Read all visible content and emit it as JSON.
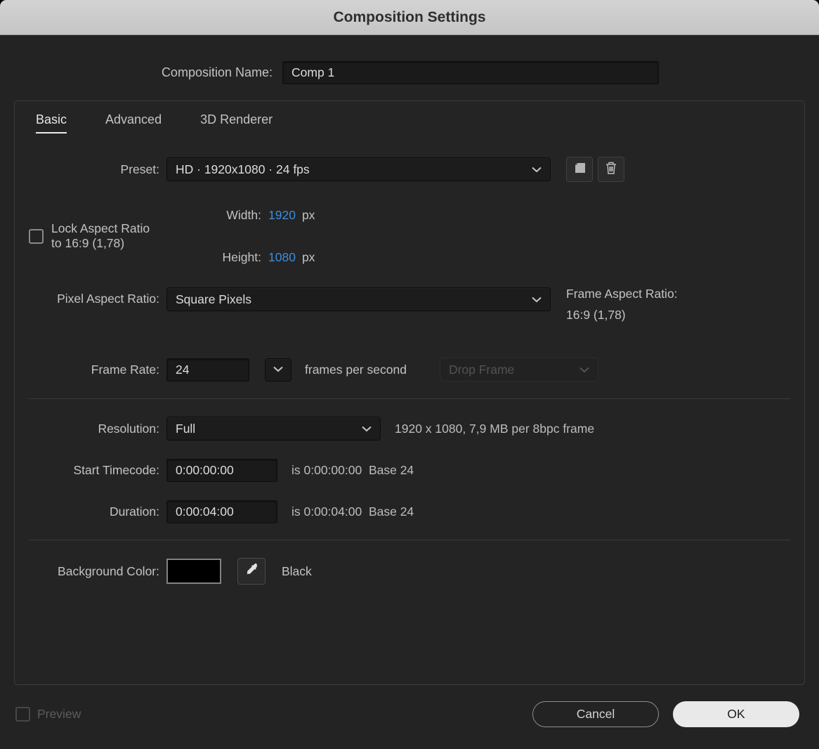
{
  "dialog": {
    "title": "Composition Settings"
  },
  "composition_name": {
    "label": "Composition Name:",
    "value": "Comp 1"
  },
  "tabs": {
    "basic": "Basic",
    "advanced": "Advanced",
    "renderer": "3D Renderer"
  },
  "preset": {
    "label": "Preset:",
    "value": "HD  ·  1920x1080 · 24 fps"
  },
  "dimensions": {
    "width_label": "Width:",
    "width_value": "1920",
    "width_unit": "px",
    "height_label": "Height:",
    "height_value": "1080",
    "height_unit": "px",
    "lock_aspect_label": "Lock Aspect Ratio to 16:9 (1,78)"
  },
  "pixel_aspect_ratio": {
    "label": "Pixel Aspect Ratio:",
    "value": "Square Pixels",
    "frame_aspect_label": "Frame Aspect Ratio:",
    "frame_aspect_value": "16:9 (1,78)"
  },
  "frame_rate": {
    "label": "Frame Rate:",
    "value": "24",
    "suffix": "frames per second",
    "drop_frame": "Drop Frame"
  },
  "resolution": {
    "label": "Resolution:",
    "value": "Full",
    "info": "1920 x 1080, 7,9 MB per 8bpc frame"
  },
  "start_timecode": {
    "label": "Start Timecode:",
    "value": "0:00:00:00",
    "info": "is 0:00:00:00  Base 24"
  },
  "duration": {
    "label": "Duration:",
    "value": "0:00:04:00",
    "info": "is 0:00:04:00  Base 24"
  },
  "background_color": {
    "label": "Background Color:",
    "swatch_color": "#000000",
    "name": "Black"
  },
  "footer": {
    "preview": "Preview",
    "cancel": "Cancel",
    "ok": "OK"
  },
  "colors": {
    "accent_blue": "#3d8de0"
  }
}
